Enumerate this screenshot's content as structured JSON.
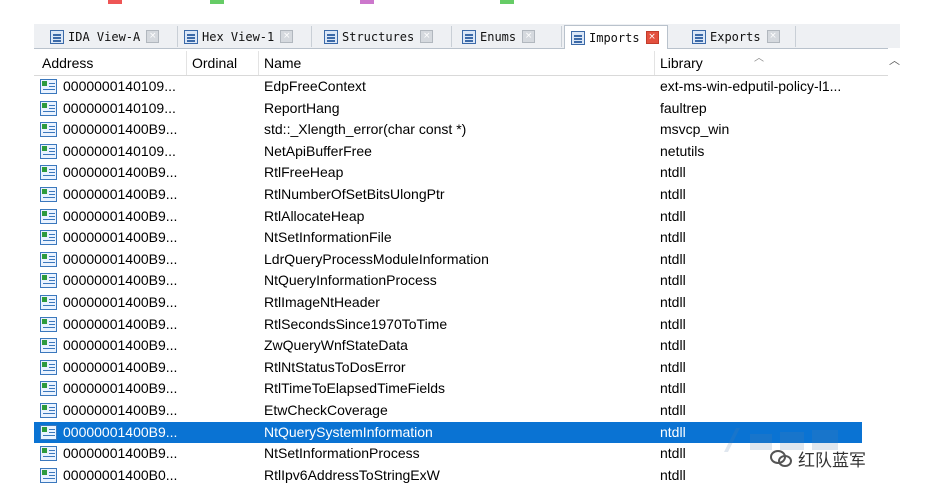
{
  "tabs": [
    {
      "label": "IDA View-A",
      "active": false,
      "icon": "ida-view-icon"
    },
    {
      "label": "Hex View-1",
      "active": false,
      "icon": "hex-view-icon"
    },
    {
      "label": "Structures",
      "active": false,
      "icon": "structures-icon"
    },
    {
      "label": "Enums",
      "active": false,
      "icon": "enums-icon"
    },
    {
      "label": "Imports",
      "active": true,
      "icon": "imports-icon"
    },
    {
      "label": "Exports",
      "active": false,
      "icon": "exports-icon"
    }
  ],
  "columns": {
    "address": "Address",
    "ordinal": "Ordinal",
    "name": "Name",
    "library": "Library"
  },
  "rows": [
    {
      "address": "0000000140109...",
      "ordinal": "",
      "name": "EdpFreeContext",
      "library": "ext-ms-win-edputil-policy-l1..."
    },
    {
      "address": "0000000140109...",
      "ordinal": "",
      "name": "ReportHang",
      "library": "faultrep"
    },
    {
      "address": "00000001400B9...",
      "ordinal": "",
      "name": "std::_Xlength_error(char const *)",
      "library": "msvcp_win"
    },
    {
      "address": "0000000140109...",
      "ordinal": "",
      "name": "NetApiBufferFree",
      "library": "netutils"
    },
    {
      "address": "00000001400B9...",
      "ordinal": "",
      "name": "RtlFreeHeap",
      "library": "ntdll"
    },
    {
      "address": "00000001400B9...",
      "ordinal": "",
      "name": "RtlNumberOfSetBitsUlongPtr",
      "library": "ntdll"
    },
    {
      "address": "00000001400B9...",
      "ordinal": "",
      "name": "RtlAllocateHeap",
      "library": "ntdll"
    },
    {
      "address": "00000001400B9...",
      "ordinal": "",
      "name": "NtSetInformationFile",
      "library": "ntdll"
    },
    {
      "address": "00000001400B9...",
      "ordinal": "",
      "name": "LdrQueryProcessModuleInformation",
      "library": "ntdll"
    },
    {
      "address": "00000001400B9...",
      "ordinal": "",
      "name": "NtQueryInformationProcess",
      "library": "ntdll"
    },
    {
      "address": "00000001400B9...",
      "ordinal": "",
      "name": "RtlImageNtHeader",
      "library": "ntdll"
    },
    {
      "address": "00000001400B9...",
      "ordinal": "",
      "name": "RtlSecondsSince1970ToTime",
      "library": "ntdll"
    },
    {
      "address": "00000001400B9...",
      "ordinal": "",
      "name": "ZwQueryWnfStateData",
      "library": "ntdll"
    },
    {
      "address": "00000001400B9...",
      "ordinal": "",
      "name": "RtlNtStatusToDosError",
      "library": "ntdll"
    },
    {
      "address": "00000001400B9...",
      "ordinal": "",
      "name": "RtlTimeToElapsedTimeFields",
      "library": "ntdll"
    },
    {
      "address": "00000001400B9...",
      "ordinal": "",
      "name": "EtwCheckCoverage",
      "library": "ntdll"
    },
    {
      "address": "00000001400B9...",
      "ordinal": "",
      "name": "NtQuerySystemInformation",
      "library": "ntdll",
      "selected": true
    },
    {
      "address": "00000001400B9...",
      "ordinal": "",
      "name": "NtSetInformationProcess",
      "library": "ntdll"
    },
    {
      "address": "00000001400B0...",
      "ordinal": "",
      "name": "RtlIpv6AddressToStringExW",
      "library": "ntdll"
    }
  ],
  "watermark": {
    "text": "红队蓝军"
  },
  "colors": {
    "selection": "#0a73d3",
    "active_tab_close": "#e3503e"
  }
}
